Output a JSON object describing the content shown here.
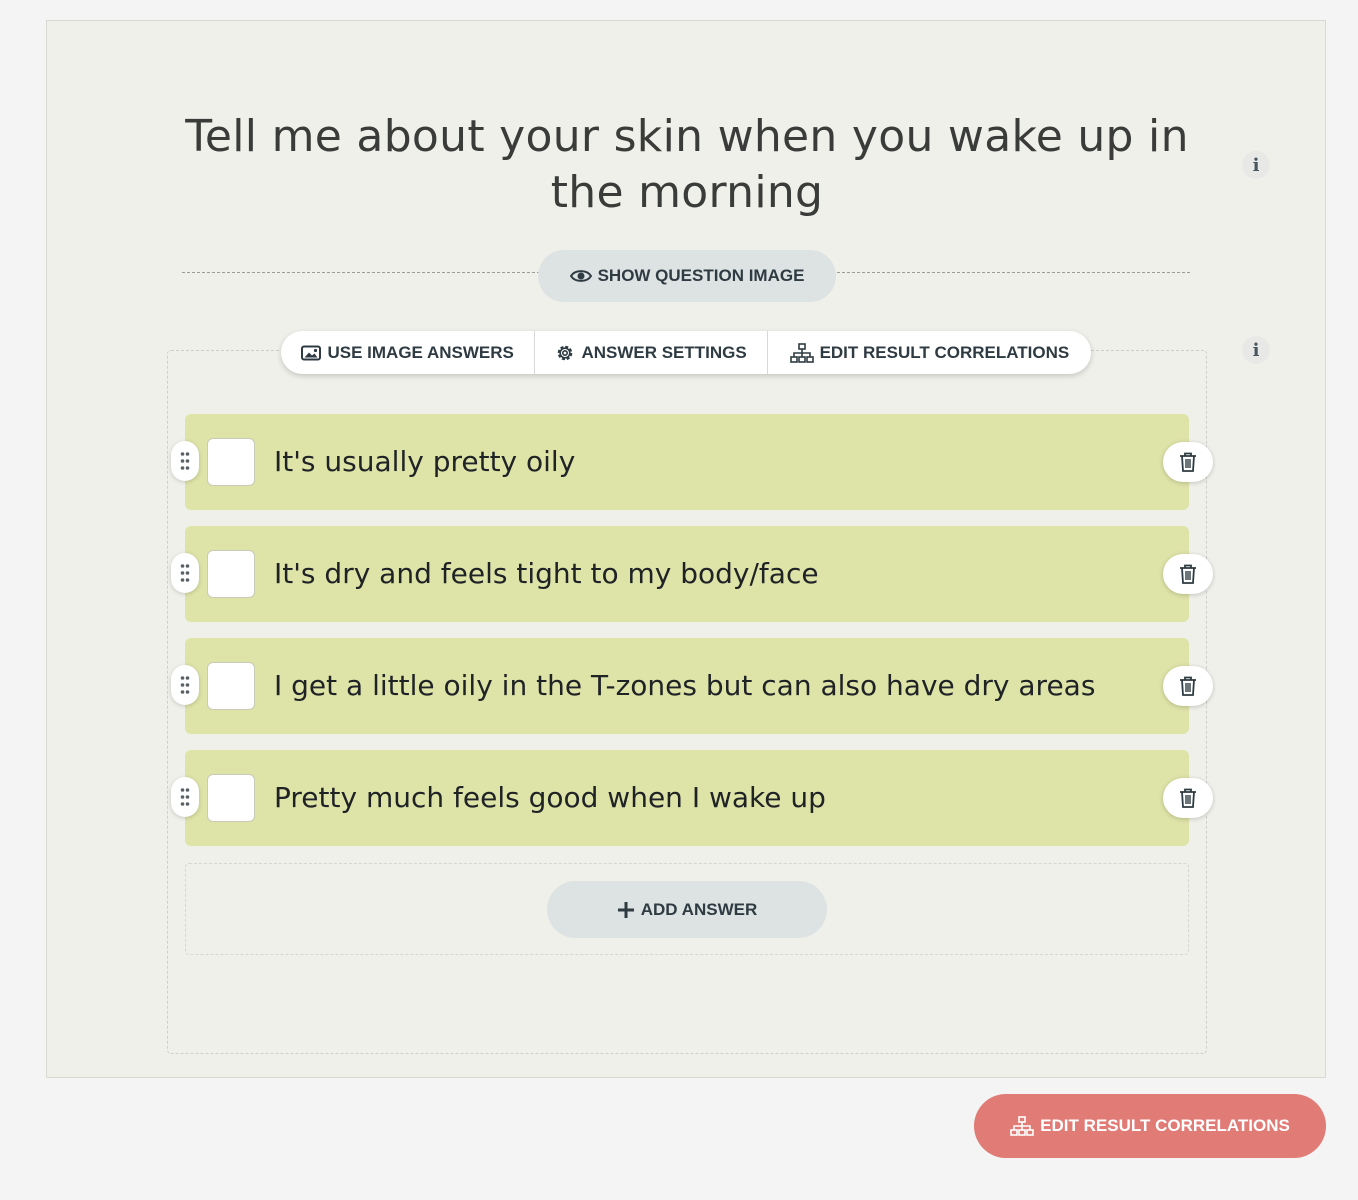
{
  "question": {
    "title": "Tell me about your skin when you wake up in the morning",
    "show_image_label": "SHOW QUESTION IMAGE",
    "info_icon": "i"
  },
  "toolbar": {
    "use_image_answers": "USE IMAGE ANSWERS",
    "answer_settings": "ANSWER SETTINGS",
    "edit_result_correlations": "EDIT RESULT CORRELATIONS"
  },
  "answers": [
    {
      "text": "It's usually pretty oily"
    },
    {
      "text": "It's dry and feels tight to my body/face"
    },
    {
      "text": "I get a little oily in the T-zones but can also have dry areas"
    },
    {
      "text": "Pretty much feels good when I wake up"
    }
  ],
  "add_answer_label": "ADD ANSWER",
  "footer": {
    "edit_result_correlations": "EDIT RESULT CORRELATIONS"
  },
  "colors": {
    "answer_bg": "#dee3a8",
    "accent_button": "#e07b76",
    "pill_bg": "#dde2e3",
    "card_bg": "#f0f0eb"
  },
  "icons": {
    "info": "info-icon",
    "eye": "eye-icon",
    "image": "image-icon",
    "gear": "gear-icon",
    "sitemap": "sitemap-icon",
    "drag": "drag-handle-icon",
    "trash": "trash-icon",
    "plus": "plus-icon"
  }
}
